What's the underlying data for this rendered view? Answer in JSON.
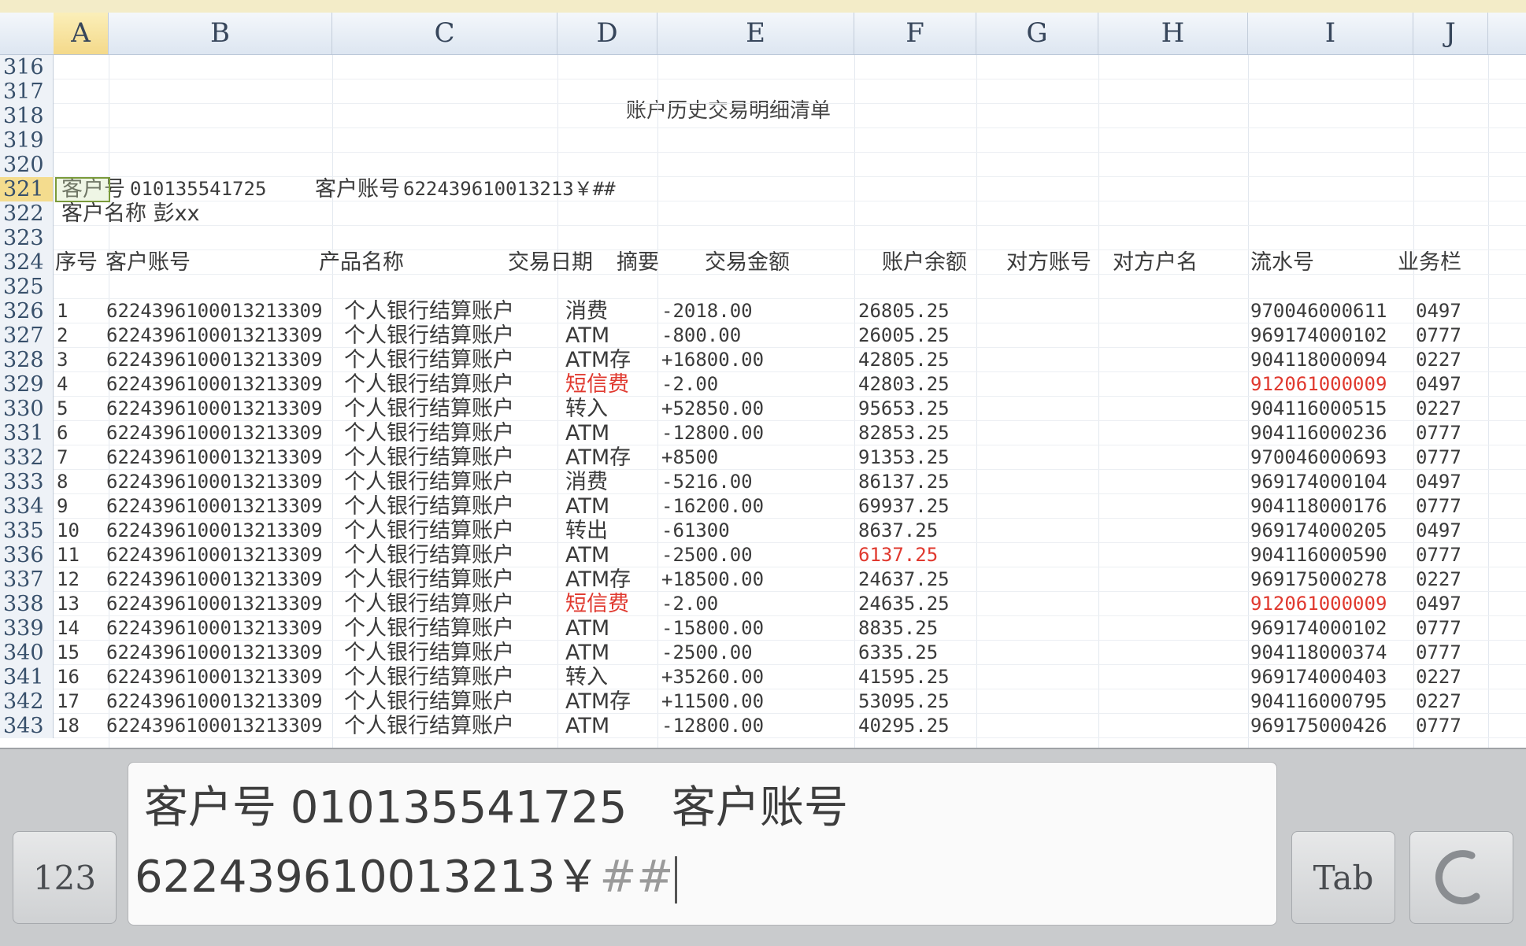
{
  "columns": [
    "A",
    "B",
    "C",
    "D",
    "E",
    "F",
    "G",
    "H",
    "I",
    "J"
  ],
  "selected_column": "A",
  "top_rows": [
    {
      "num": "316"
    },
    {
      "num": "317"
    },
    {
      "num": "318"
    },
    {
      "num": "319"
    },
    {
      "num": "320"
    },
    {
      "num": "321"
    },
    {
      "num": "322"
    },
    {
      "num": "323"
    },
    {
      "num": "324"
    },
    {
      "num": "325"
    }
  ],
  "sheet_title": "账户历史交易明细清单",
  "customer_line": {
    "label": "客户号",
    "id": "010135541725",
    "acct_label": "客户账号",
    "acct": "622439610013213￥##"
  },
  "customer_name": "客户名称 彭xx",
  "headers": [
    "序号",
    "客户账号",
    "产品名称",
    "交易日期",
    "摘要",
    "交易金额",
    "账户余额",
    "对方账号",
    "对方户名",
    "流水号",
    "业务栏"
  ],
  "rows": [
    {
      "num": "326",
      "seq": "1",
      "acct": "6224396100013213309",
      "prod": "个人银行结算账户",
      "memo": "消费",
      "amount": "-2018.00",
      "balance": "26805.25",
      "serial": "970046000611",
      "biz": "0497"
    },
    {
      "num": "327",
      "seq": "2",
      "acct": "6224396100013213309",
      "prod": "个人银行结算账户",
      "memo": "ATM",
      "amount": "-800.00",
      "balance": "26005.25",
      "serial": "969174000102",
      "biz": "0777"
    },
    {
      "num": "328",
      "seq": "3",
      "acct": "6224396100013213309",
      "prod": "个人银行结算账户",
      "memo": "ATM存",
      "amount": "+16800.00",
      "balance": "42805.25",
      "serial": "904118000094",
      "biz": "0227"
    },
    {
      "num": "329",
      "seq": "4",
      "acct": "6224396100013213309",
      "prod": "个人银行结算账户",
      "memo": "短信费",
      "memo_red": true,
      "amount": "-2.00",
      "balance": "42803.25",
      "serial": "912061000009",
      "serial_red": true,
      "biz": "0497"
    },
    {
      "num": "330",
      "seq": "5",
      "acct": "6224396100013213309",
      "prod": "个人银行结算账户",
      "memo": "转入",
      "amount": "+52850.00",
      "balance": "95653.25",
      "serial": "904116000515",
      "biz": "0227"
    },
    {
      "num": "331",
      "seq": "6",
      "acct": "6224396100013213309",
      "prod": "个人银行结算账户",
      "memo": "ATM",
      "amount": "-12800.00",
      "balance": "82853.25",
      "serial": "904116000236",
      "biz": "0777"
    },
    {
      "num": "332",
      "seq": "7",
      "acct": "6224396100013213309",
      "prod": "个人银行结算账户",
      "memo": "ATM存",
      "amount": "+8500",
      "balance": "91353.25",
      "serial": "970046000693",
      "biz": "0777"
    },
    {
      "num": "333",
      "seq": "8",
      "acct": "6224396100013213309",
      "prod": "个人银行结算账户",
      "memo": "消费",
      "amount": "-5216.00",
      "balance": "86137.25",
      "serial": "969174000104",
      "biz": "0497"
    },
    {
      "num": "334",
      "seq": "9",
      "acct": "6224396100013213309",
      "prod": "个人银行结算账户",
      "memo": "ATM",
      "amount": "-16200.00",
      "balance": "69937.25",
      "serial": "904118000176",
      "biz": "0777"
    },
    {
      "num": "335",
      "seq": "10",
      "acct": "6224396100013213309",
      "prod": "个人银行结算账户",
      "memo": "转出",
      "amount": "-61300",
      "balance": "8637.25",
      "serial": "969174000205",
      "biz": "0497"
    },
    {
      "num": "336",
      "seq": "11",
      "acct": "6224396100013213309",
      "prod": "个人银行结算账户",
      "memo": "ATM",
      "amount": "-2500.00",
      "balance": "6137.25",
      "balance_red": true,
      "serial": "904116000590",
      "biz": "0777"
    },
    {
      "num": "337",
      "seq": "12",
      "acct": "6224396100013213309",
      "prod": "个人银行结算账户",
      "memo": "ATM存",
      "amount": "+18500.00",
      "balance": "24637.25",
      "serial": "969175000278",
      "biz": "0227"
    },
    {
      "num": "338",
      "seq": "13",
      "acct": "6224396100013213309",
      "prod": "个人银行结算账户",
      "memo": "短信费",
      "memo_red": true,
      "amount": "-2.00",
      "balance": "24635.25",
      "serial": "912061000009",
      "serial_red": true,
      "biz": "0497"
    },
    {
      "num": "339",
      "seq": "14",
      "acct": "6224396100013213309",
      "prod": "个人银行结算账户",
      "memo": "ATM",
      "amount": "-15800.00",
      "balance": "8835.25",
      "serial": "969174000102",
      "biz": "0777"
    },
    {
      "num": "340",
      "seq": "15",
      "acct": "6224396100013213309",
      "prod": "个人银行结算账户",
      "memo": "ATM",
      "amount": "-2500.00",
      "balance": "6335.25",
      "serial": "904118000374",
      "biz": "0777"
    },
    {
      "num": "341",
      "seq": "16",
      "acct": "6224396100013213309",
      "prod": "个人银行结算账户",
      "memo": "转入",
      "amount": "+35260.00",
      "balance": "41595.25",
      "serial": "969174000403",
      "biz": "0227"
    },
    {
      "num": "342",
      "seq": "17",
      "acct": "6224396100013213309",
      "prod": "个人银行结算账户",
      "memo": "ATM存",
      "amount": "+11500.00",
      "balance": "53095.25",
      "serial": "904116000795",
      "biz": "0227"
    },
    {
      "num": "343",
      "seq": "18",
      "acct": "6224396100013213309",
      "prod": "个人银行结算账户",
      "memo": "ATM",
      "amount": "-12800.00",
      "balance": "40295.25",
      "serial": "969175000426",
      "biz": "0777"
    }
  ],
  "keyboard": {
    "key_123": "123",
    "key_tab": "Tab",
    "key_undo_icon": "undo-arc-icon",
    "edit_line1_a": "客户号 010135541725",
    "edit_line1_b": "客户账号",
    "edit_line2_value": "622439610013213￥",
    "edit_line2_grey": "##"
  },
  "colors": {
    "accent_red": "#e0392f",
    "header_selected": "#f4d98a"
  }
}
